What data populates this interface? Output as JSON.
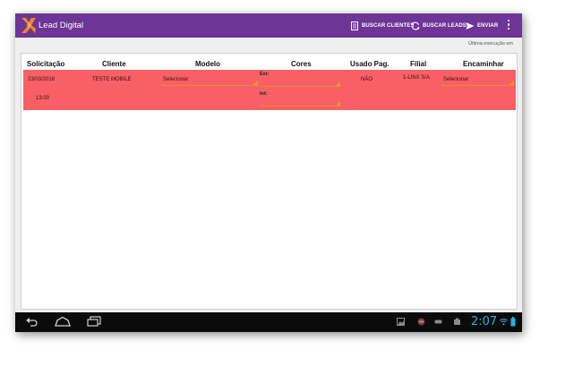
{
  "app": {
    "title": "Lead Digital"
  },
  "toolbar": {
    "buscar_clientes": "BUSCAR CLIENTES",
    "buscar_leads": "BUSCAR LEADS",
    "enviar": "ENVIAR"
  },
  "status_text": "Última execução em",
  "table": {
    "columns": [
      "Solicitação",
      "Cliente",
      "Modelo",
      "Cores",
      "Usado Pag.",
      "Filial",
      "Encaminhar"
    ],
    "rows": [
      {
        "date": "23/03/2016",
        "time": "13:00",
        "cliente": "TESTE MOBILE",
        "modelo": "Selecionar",
        "cor_ext_label": "Ext:",
        "cor_int_label": "Int:",
        "usado_pag": "NÃO",
        "filial": "1-LINX S/A",
        "encaminhar": "Selecionar"
      }
    ]
  },
  "system_bar": {
    "clock": "2:07"
  },
  "colors": {
    "appbar": "#6c3596",
    "row_highlight": "#f85f66",
    "accent": "#e2a017",
    "clock": "#27b3e6"
  }
}
